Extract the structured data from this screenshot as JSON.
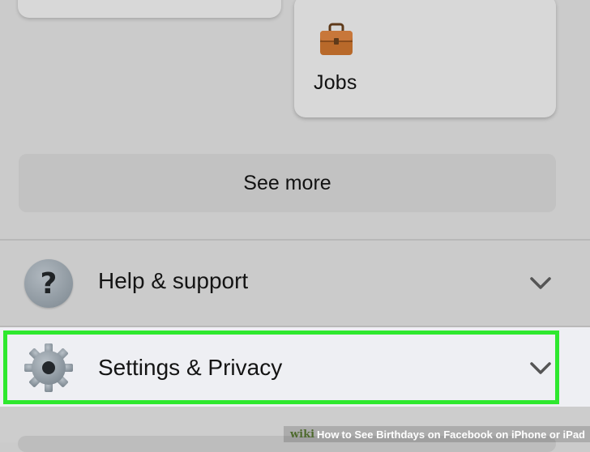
{
  "shortcuts": {
    "jobs": {
      "label": "Jobs",
      "icon": "briefcase-icon"
    }
  },
  "see_more": {
    "label": "See more"
  },
  "menu": {
    "help": {
      "label": "Help & support",
      "icon": "question-icon"
    },
    "settings": {
      "label": "Settings & Privacy",
      "icon": "gear-icon"
    }
  },
  "colors": {
    "highlight": "#2ee82e",
    "background": "#cbcbcb",
    "selected_row": "#eeeff3"
  },
  "watermark": {
    "brand": "wiki",
    "how": "How",
    "title": "to See Birthdays on Facebook on iPhone or iPad"
  }
}
